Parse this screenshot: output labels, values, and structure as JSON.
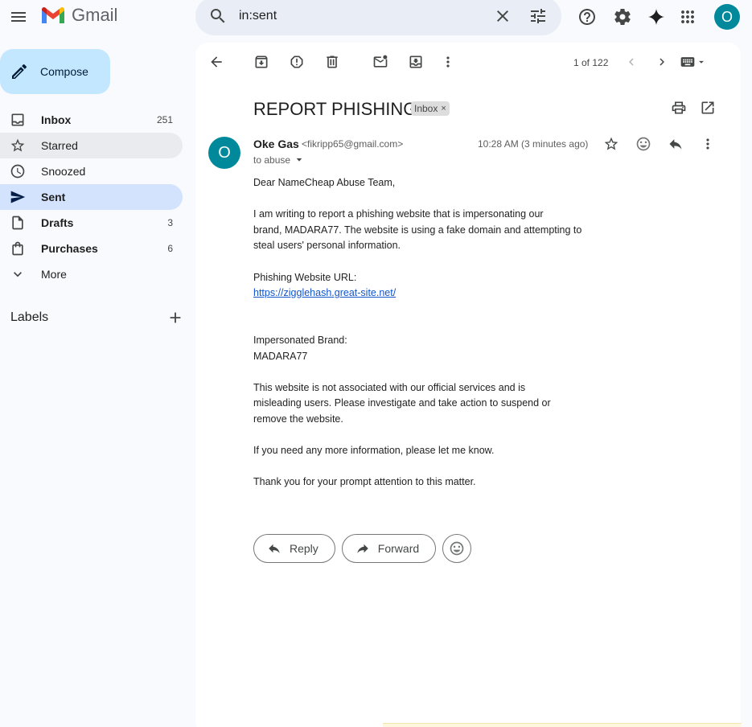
{
  "app": {
    "name": "Gmail"
  },
  "colors": {
    "accent": "#0b57d0",
    "compose_bg": "#c2e7ff",
    "active_nav_bg": "#d3e3fd",
    "avatar": "#00899b",
    "link": "#1155cc"
  },
  "search": {
    "value": "in:sent"
  },
  "user": {
    "avatar_initial": "O"
  },
  "compose": {
    "label": "Compose"
  },
  "nav": [
    {
      "label": "Inbox",
      "count": "251",
      "icon": "inbox-icon"
    },
    {
      "label": "Starred",
      "count": "",
      "icon": "star-icon"
    },
    {
      "label": "Snoozed",
      "count": "",
      "icon": "clock-icon"
    },
    {
      "label": "Sent",
      "count": "",
      "icon": "send-icon"
    },
    {
      "label": "Drafts",
      "count": "3",
      "icon": "draft-icon"
    },
    {
      "label": "Purchases",
      "count": "6",
      "icon": "shopping-bag-icon"
    },
    {
      "label": "More",
      "count": "",
      "icon": "chevron-down-icon"
    }
  ],
  "labels": {
    "title": "Labels"
  },
  "pager": {
    "text": "1 of 122"
  },
  "message": {
    "subject": "REPORT PHISHING",
    "chip": "Inbox",
    "chip_close": "×",
    "sender_initial": "O",
    "sender_name": "Oke Gas",
    "sender_email": "<fikripp65@gmail.com>",
    "to": "to abuse",
    "time": "10:28 AM (3 minutes ago)",
    "body": {
      "greeting": "Dear NameCheap Abuse Team,",
      "p1_l1": "I am writing to report a phishing website that is impersonating our",
      "p1_l2": "brand, MADARA77. The website is using a fake domain and attempting to",
      "p1_l3": "steal users' personal information.",
      "url_label": "Phishing Website URL:",
      "url": "https://zigglehash.great-site.net/",
      "brand_label": "Impersonated Brand:",
      "brand": "MADARA77",
      "p2_l1": "This website is not associated with our official services and is",
      "p2_l2": "misleading users. Please investigate and take action to suspend or",
      "p2_l3": "remove the website.",
      "p3": "If you need any more information, please let me know.",
      "p4": "Thank you for your prompt attention to this matter."
    }
  },
  "actions": {
    "reply": "Reply",
    "forward": "Forward"
  }
}
